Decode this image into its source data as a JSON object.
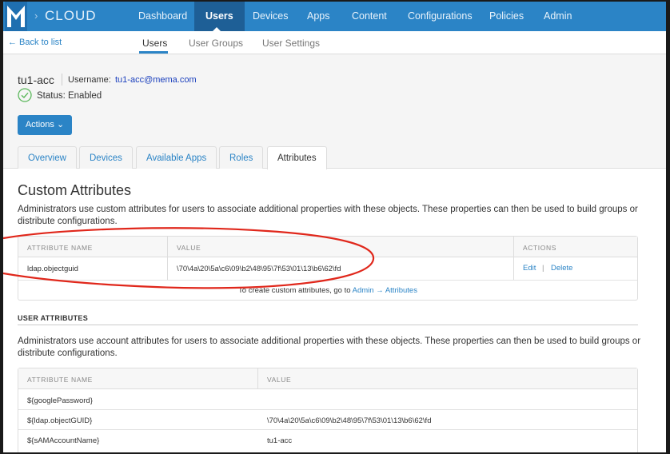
{
  "nav": {
    "brand": "CLOUD",
    "chevron": "›",
    "items": [
      {
        "label": "Dashboard"
      },
      {
        "label": "Users"
      },
      {
        "label": "Devices"
      },
      {
        "label": "Apps"
      },
      {
        "label": "Content"
      },
      {
        "label": "Configurations"
      },
      {
        "label": "Policies"
      },
      {
        "label": "Admin"
      }
    ],
    "active": "Users"
  },
  "subnav": {
    "back": "← Back to list",
    "tabs": [
      {
        "label": "Users"
      },
      {
        "label": "User Groups"
      },
      {
        "label": "User Settings"
      }
    ]
  },
  "user": {
    "id": "tu1-acc",
    "username_label": "Username:",
    "username": "tu1-acc@mema.com",
    "status": "Status: Enabled",
    "actions_label": "Actions ⌄"
  },
  "tabs": [
    {
      "label": "Overview"
    },
    {
      "label": "Devices"
    },
    {
      "label": "Available Apps"
    },
    {
      "label": "Roles"
    },
    {
      "label": "Attributes"
    }
  ],
  "custom": {
    "title": "Custom Attributes",
    "description": "Administrators use custom attributes for users to associate additional properties with these objects. These properties can then be used to build groups or distribute configurations.",
    "headers": {
      "name": "ATTRIBUTE NAME",
      "value": "VALUE",
      "actions": "ACTIONS"
    },
    "row": {
      "name": "ldap.objectguid",
      "value": "\\70\\4a\\20\\5a\\c6\\09\\b2\\48\\95\\7f\\53\\01\\13\\b6\\62\\fd",
      "edit": "Edit",
      "separator": "|",
      "delete": "Delete"
    },
    "footer_text": "To create custom attributes, go to",
    "footer_link": "Admin → Attributes"
  },
  "user_attrs": {
    "heading": "USER ATTRIBUTES",
    "description": "Administrators use account attributes for users to associate additional properties with these objects. These properties can then be used to build groups or distribute configurations.",
    "headers": {
      "name": "ATTRIBUTE NAME",
      "value": "VALUE"
    },
    "rows": [
      {
        "name": "${googlePassword}",
        "value": ""
      },
      {
        "name": "${ldap.objectGUID}",
        "value": "\\70\\4a\\20\\5a\\c6\\09\\b2\\48\\95\\7f\\53\\01\\13\\b6\\62\\fd"
      },
      {
        "name": "${sAMAccountName}",
        "value": "tu1-acc"
      }
    ]
  },
  "colors": {
    "nav": "#2b84c6",
    "nav_active": "#1e5f96",
    "annotation": "#e0271b",
    "status_ok": "#5cb85c"
  }
}
